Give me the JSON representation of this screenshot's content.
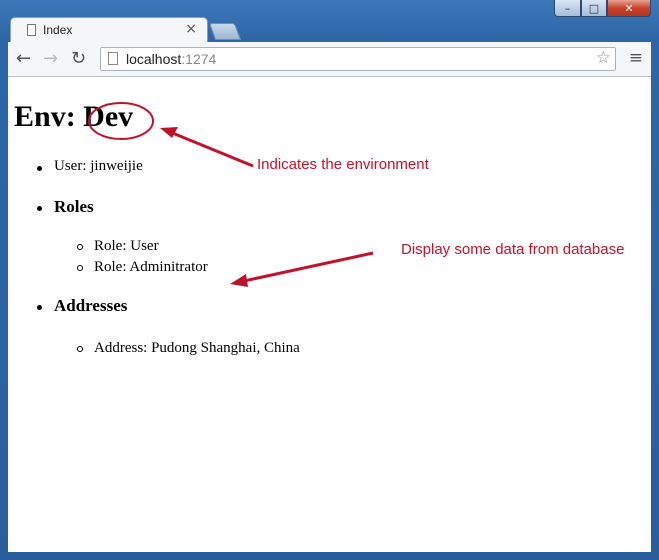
{
  "browser": {
    "tab_title": "Index",
    "tab_close": "×",
    "url_host": "localhost",
    "url_port": ":1274"
  },
  "page": {
    "heading": "Env: Dev",
    "user": "User: jinweijie",
    "roles_heading": "Roles",
    "roles": [
      "Role: User",
      "Role: Adminitrator"
    ],
    "addresses_heading": "Addresses",
    "addresses": [
      "Address: Pudong Shanghai, China"
    ]
  },
  "annotations": {
    "env_note": "Indicates the environment",
    "data_note": "Display some data from database",
    "color": "#c0132b"
  }
}
